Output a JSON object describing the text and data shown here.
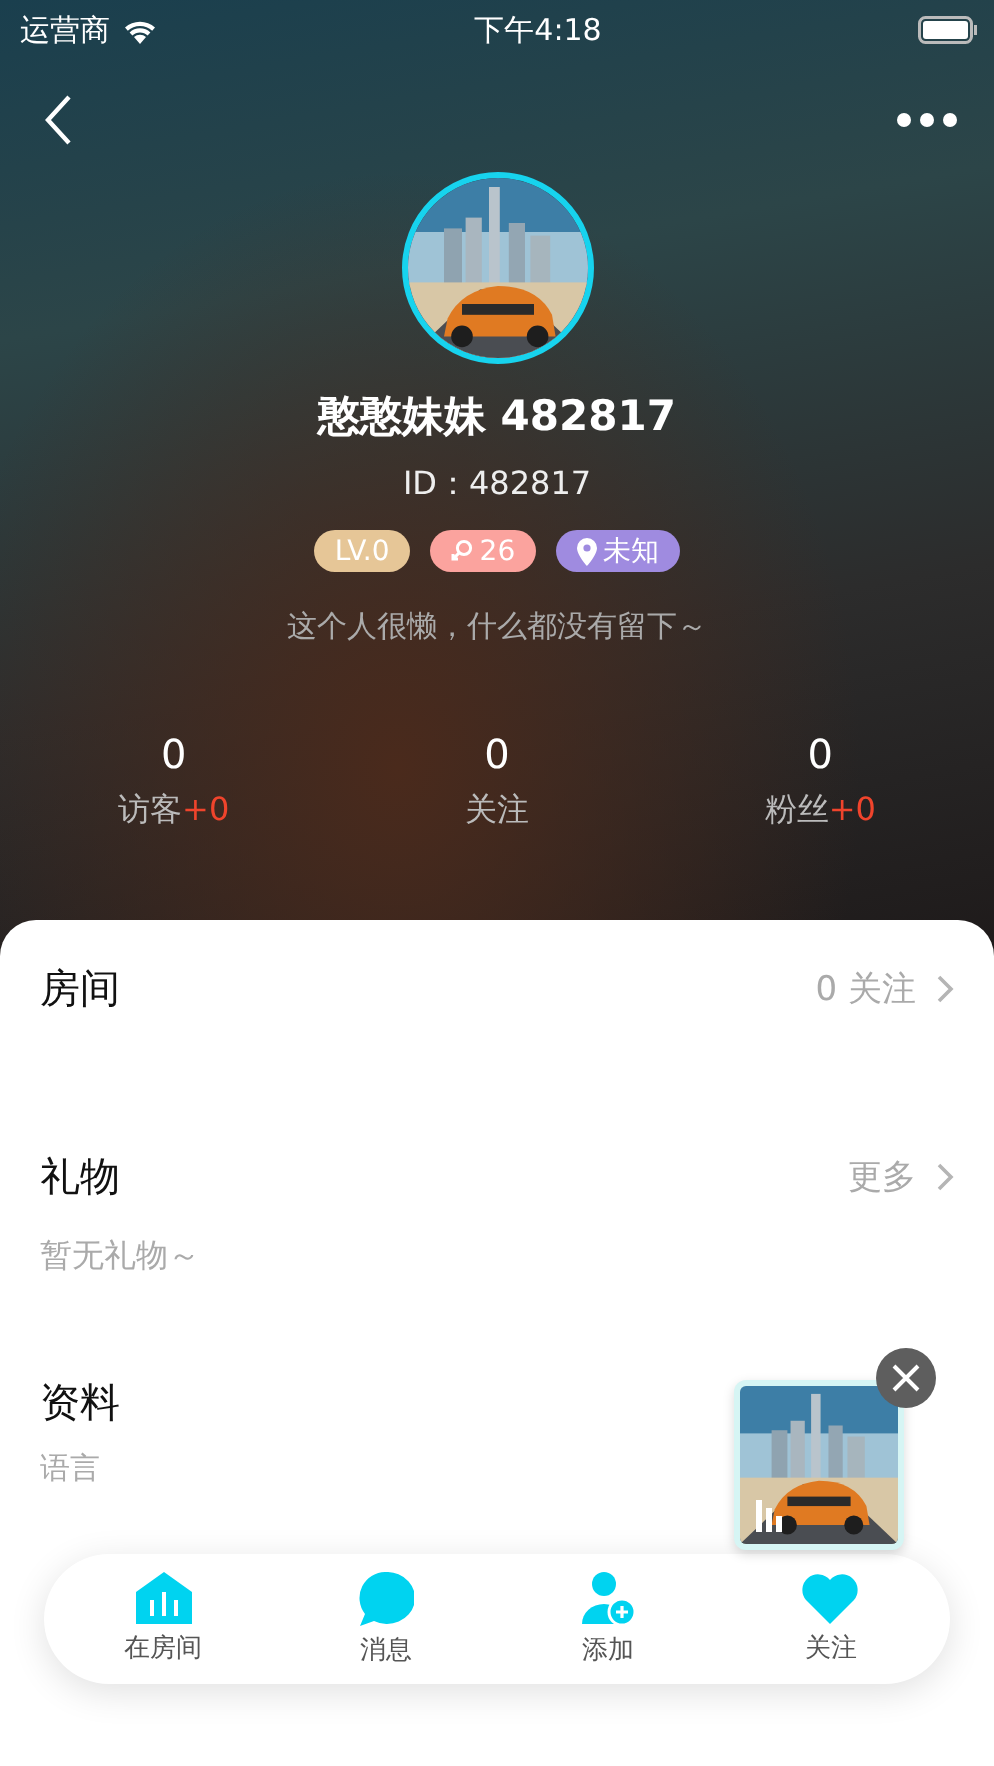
{
  "status_bar": {
    "carrier": "运营商",
    "time": "下午4:18"
  },
  "profile": {
    "name": "憨憨妹妹 482817",
    "id": "ID：482817",
    "bio": "这个人很懒，什么都没有留下～",
    "badges": [
      {
        "kind": "level",
        "text": "LV.0",
        "color": "#e6c697"
      },
      {
        "kind": "gender",
        "text": "26",
        "color": "#fba39e"
      },
      {
        "kind": "location",
        "text": "未知",
        "color": "#9f8be0"
      }
    ]
  },
  "stats": [
    {
      "value": "0",
      "label": "访客",
      "delta": "+0"
    },
    {
      "value": "0",
      "label": "关注"
    },
    {
      "value": "0",
      "label": "粉丝",
      "delta": "+0"
    }
  ],
  "sections": [
    {
      "title": "房间",
      "action": "0 关注"
    },
    {
      "title": "礼物",
      "action": "更多",
      "empty_text": "暂无礼物～"
    },
    {
      "title": "资料",
      "fields": [
        "语言"
      ]
    }
  ],
  "bottom_nav": [
    {
      "kind": "room",
      "label": "在房间"
    },
    {
      "kind": "message",
      "label": "消息"
    },
    {
      "kind": "add",
      "label": "添加"
    },
    {
      "kind": "follow",
      "label": "关注"
    }
  ]
}
